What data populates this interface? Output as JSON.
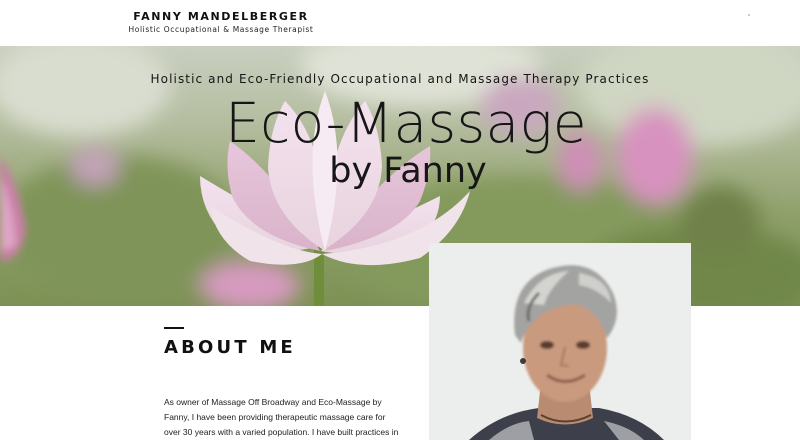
{
  "header": {
    "brand_name": "FANNY MANDELBERGER",
    "brand_tagline": "Holistic Occupational & Massage Therapist"
  },
  "hero": {
    "subtitle": "Holistic and Eco-Friendly Occupational and Massage Therapy Practices",
    "title_line1": "Eco-Massage",
    "title_line2": "by Fanny"
  },
  "about": {
    "heading": "ABOUT ME",
    "paragraph": "As owner of Massage Off Broadway and Eco-Massage by Fanny, I have been providing therapeutic massage care for over 30 years with a varied population.  I have built practices in NY, Miami, DC & Maryland and work with conflict..."
  },
  "colors": {
    "background": "#ffffff",
    "text": "#111111",
    "hero_green": "#8fa06a",
    "lotus_pink": "#e9b8d0"
  }
}
